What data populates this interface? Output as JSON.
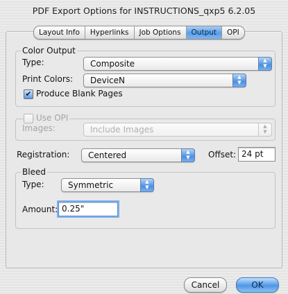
{
  "window": {
    "title": "PDF Export Options for INSTRUCTIONS_qxp5 6.2.05"
  },
  "tabs": [
    {
      "label": "Layout Info",
      "active": false
    },
    {
      "label": "Hyperlinks",
      "active": false
    },
    {
      "label": "Job Options",
      "active": false
    },
    {
      "label": "Output",
      "active": true
    },
    {
      "label": "OPI",
      "active": false
    }
  ],
  "color_output": {
    "legend": "Color Output",
    "type_label": "Type:",
    "type_value": "Composite",
    "print_colors_label": "Print Colors:",
    "print_colors_value": "DeviceN",
    "produce_blank_label": "Produce Blank Pages",
    "produce_blank_checked": true
  },
  "opi": {
    "legend": "Use OPI",
    "checked": false,
    "images_label": "Images:",
    "images_value": "Include Images"
  },
  "registration": {
    "label": "Registration:",
    "value": "Centered",
    "offset_label": "Offset:",
    "offset_value": "24 pt"
  },
  "bleed": {
    "legend": "Bleed",
    "type_label": "Type:",
    "type_value": "Symmetric",
    "amount_label": "Amount:",
    "amount_value": "0.25\""
  },
  "buttons": {
    "cancel": "Cancel",
    "ok": "OK"
  },
  "colors": {
    "accent": "#5a9ee8",
    "disabled_text": "#a4a4a4"
  }
}
